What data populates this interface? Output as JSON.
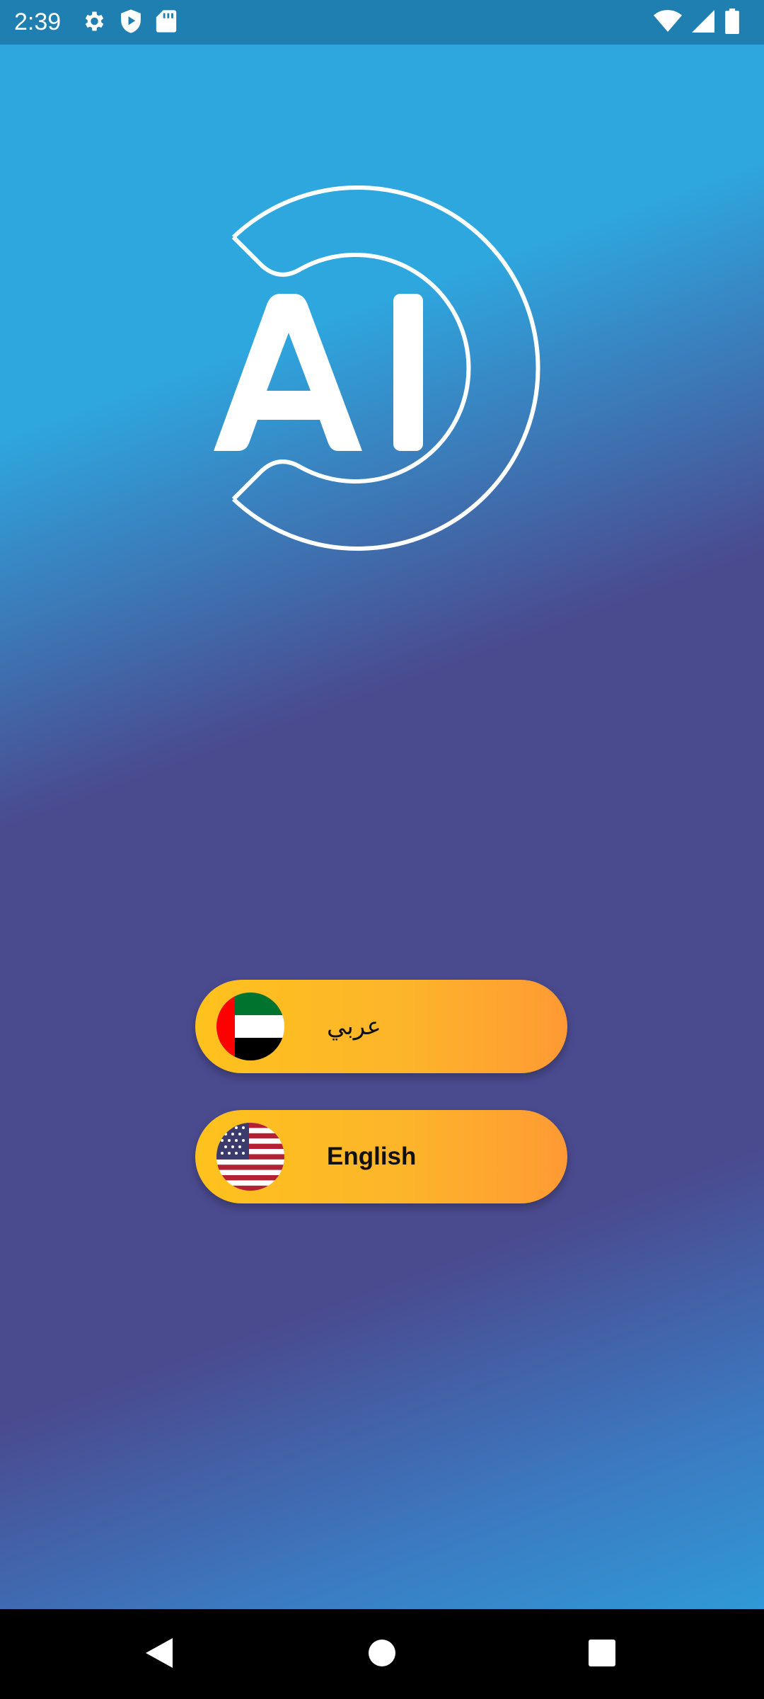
{
  "status_bar": {
    "time": "2:39",
    "left_icons": [
      "gear-icon",
      "shield-play-icon",
      "sd-card-icon"
    ],
    "right_icons": [
      "wifi-icon",
      "cellular-signal-icon",
      "battery-icon"
    ]
  },
  "logo": {
    "text": "AI",
    "color": "#ffffff"
  },
  "language_buttons": [
    {
      "label": "عربي",
      "flag": "uae-flag-icon"
    },
    {
      "label": "English",
      "flag": "us-flag-icon"
    }
  ],
  "navigation_bar": {
    "buttons": [
      "back-icon",
      "home-icon",
      "recents-icon"
    ]
  },
  "colors": {
    "status_bar": "#1f7fb0",
    "button_start": "#fec21d",
    "button_end": "#fe9a34",
    "background_top": "#2ea7df",
    "background_middle": "#4a4a8f"
  }
}
